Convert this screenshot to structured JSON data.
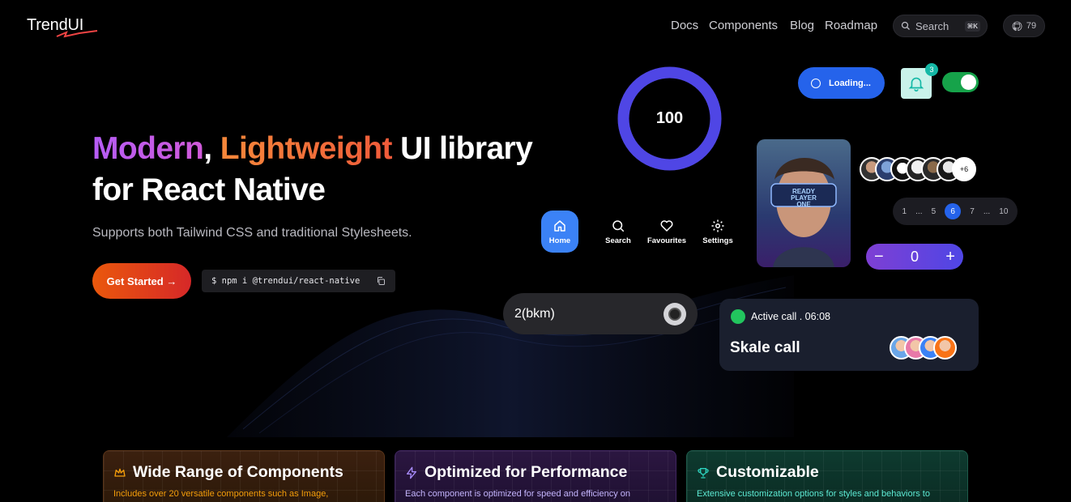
{
  "header": {
    "logo": "TrendUI",
    "nav": [
      "Docs",
      "Components",
      "Blog",
      "Roadmap"
    ],
    "search": {
      "label": "Search",
      "shortcut": "⌘K"
    },
    "github_stars": "79"
  },
  "hero": {
    "title_part1": "Modern",
    "title_sep": ", ",
    "title_part2": "Lightweight",
    "title_part3": " UI library",
    "title_line2": "for React Native",
    "subtitle": "Supports both Tailwind CSS and traditional Stylesheets.",
    "cta": "Get Started →",
    "install_cmd": "$ npm i @trendui/react-native"
  },
  "showcase": {
    "progress": {
      "value": "100",
      "fraction": 1.0,
      "color": "#4f46e5"
    },
    "loading_label": "Loading...",
    "notification_count": "3",
    "toggle_on": true,
    "poster_text": "READY PLAYER ONE",
    "avatar_more": "+6",
    "pagination": [
      "1",
      "...",
      "5",
      "6",
      "7",
      "...",
      "10"
    ],
    "pagination_active": "6",
    "stepper_value": "0",
    "stepper_minus": "−",
    "stepper_plus": "+",
    "tabs": [
      {
        "label": "Home",
        "icon": "home-icon",
        "active": true
      },
      {
        "label": "Search",
        "icon": "search-icon",
        "active": false
      },
      {
        "label": "Favourites",
        "icon": "heart-icon",
        "active": false
      },
      {
        "label": "Settings",
        "icon": "gear-icon",
        "active": false
      }
    ],
    "pill_text": "2(bkm)",
    "call": {
      "status": "Active call . 06:08",
      "title": "Skale call"
    }
  },
  "features": [
    {
      "title": "Wide Range of Components",
      "icon": "crown-icon",
      "desc": "Includes over 20 versatile components such as Image,"
    },
    {
      "title": "Optimized for Performance",
      "icon": "lightning-icon",
      "desc": "Each component is optimized for speed and efficiency on"
    },
    {
      "title": "Customizable",
      "icon": "trophy-icon",
      "desc": "Extensive customization options for styles and behaviors to"
    }
  ],
  "colors": {
    "accent_blue": "#2563eb",
    "cta_start": "#ea580c",
    "cta_end": "#d62828",
    "toggle_green": "#16a34a"
  }
}
